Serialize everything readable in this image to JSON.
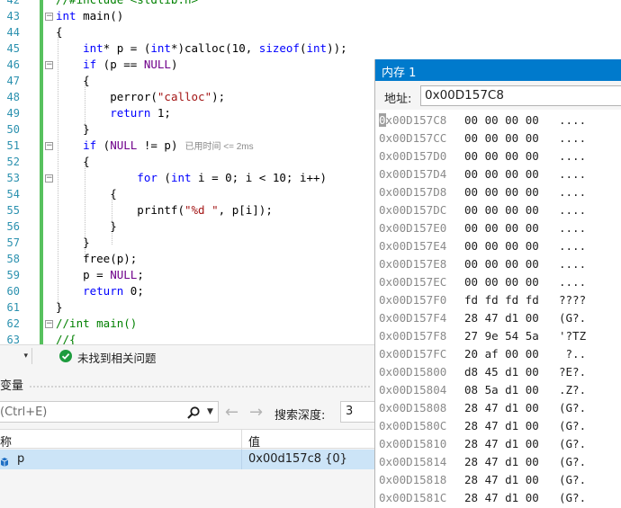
{
  "editor": {
    "lines": [
      {
        "num": "42",
        "tokens": [
          {
            "t": "//#include <stdlib.h>",
            "c": "cmt"
          }
        ]
      },
      {
        "num": "43",
        "tokens": [
          {
            "t": "int",
            "c": "kw"
          },
          {
            "t": " main()",
            "c": ""
          }
        ]
      },
      {
        "num": "44",
        "tokens": [
          {
            "t": "{",
            "c": ""
          }
        ]
      },
      {
        "num": "45",
        "tokens": [
          {
            "t": "    int",
            "c": "kw"
          },
          {
            "t": "* p = (",
            "c": ""
          },
          {
            "t": "int",
            "c": "kw"
          },
          {
            "t": "*)calloc(10, ",
            "c": ""
          },
          {
            "t": "sizeof",
            "c": "kw"
          },
          {
            "t": "(",
            "c": ""
          },
          {
            "t": "int",
            "c": "kw"
          },
          {
            "t": "));",
            "c": ""
          }
        ]
      },
      {
        "num": "46",
        "tokens": [
          {
            "t": "    if",
            "c": "kw"
          },
          {
            "t": " (p == ",
            "c": ""
          },
          {
            "t": "NULL",
            "c": "mac"
          },
          {
            "t": ")",
            "c": ""
          }
        ]
      },
      {
        "num": "47",
        "tokens": [
          {
            "t": "    {",
            "c": ""
          }
        ]
      },
      {
        "num": "48",
        "tokens": [
          {
            "t": "        perror(",
            "c": ""
          },
          {
            "t": "\"calloc\"",
            "c": "str"
          },
          {
            "t": ");",
            "c": ""
          }
        ]
      },
      {
        "num": "49",
        "tokens": [
          {
            "t": "        return",
            "c": "kw"
          },
          {
            "t": " 1;",
            "c": ""
          }
        ]
      },
      {
        "num": "50",
        "tokens": [
          {
            "t": "    }",
            "c": ""
          }
        ]
      },
      {
        "num": "51",
        "tokens": [
          {
            "t": "    if",
            "c": "kw"
          },
          {
            "t": " (",
            "c": ""
          },
          {
            "t": "NULL",
            "c": "mac"
          },
          {
            "t": " != p)",
            "c": ""
          }
        ]
      },
      {
        "num": "52",
        "tokens": [
          {
            "t": "    {",
            "c": ""
          }
        ]
      },
      {
        "num": "53",
        "tokens": [
          {
            "t": "            for",
            "c": "kw"
          },
          {
            "t": " (",
            "c": ""
          },
          {
            "t": "int",
            "c": "kw"
          },
          {
            "t": " i = 0; i < 10; i++)",
            "c": ""
          }
        ]
      },
      {
        "num": "54",
        "tokens": [
          {
            "t": "        {",
            "c": ""
          }
        ]
      },
      {
        "num": "55",
        "tokens": [
          {
            "t": "            printf(",
            "c": ""
          },
          {
            "t": "\"%d \"",
            "c": "str"
          },
          {
            "t": ", p[i]);",
            "c": ""
          }
        ]
      },
      {
        "num": "56",
        "tokens": [
          {
            "t": "        }",
            "c": ""
          }
        ]
      },
      {
        "num": "57",
        "tokens": [
          {
            "t": "    }",
            "c": ""
          }
        ]
      },
      {
        "num": "58",
        "tokens": [
          {
            "t": "    free(p);",
            "c": ""
          }
        ]
      },
      {
        "num": "59",
        "tokens": [
          {
            "t": "    p = ",
            "c": ""
          },
          {
            "t": "NULL",
            "c": "mac"
          },
          {
            "t": ";",
            "c": ""
          }
        ]
      },
      {
        "num": "60",
        "tokens": [
          {
            "t": "    return",
            "c": "kw"
          },
          {
            "t": " 0;",
            "c": ""
          }
        ]
      },
      {
        "num": "61",
        "tokens": [
          {
            "t": "}",
            "c": ""
          }
        ]
      },
      {
        "num": "62",
        "tokens": [
          {
            "t": "//int main()",
            "c": "cmt"
          }
        ]
      },
      {
        "num": "63",
        "tokens": [
          {
            "t": "//{",
            "c": "cmt"
          }
        ]
      }
    ],
    "perf_hint": "已用时间 <= 2ms"
  },
  "statusbar": {
    "issues_text": "未找到相关问题"
  },
  "variables": {
    "title": "变量",
    "search_placeholder": "(Ctrl+E)",
    "depth_label": "搜索深度:",
    "depth_value": "3",
    "col_name": "称",
    "col_value": "值",
    "rows": [
      {
        "name": "p",
        "value": "0x00d157c8 {0}"
      }
    ]
  },
  "memory": {
    "title": "内存 1",
    "addr_label": "地址:",
    "addr_value": "0x00D157C8",
    "rows": [
      {
        "addr": "0x00D157C8",
        "bytes": "00 00 00 00",
        "ascii": "...."
      },
      {
        "addr": "0x00D157CC",
        "bytes": "00 00 00 00",
        "ascii": "...."
      },
      {
        "addr": "0x00D157D0",
        "bytes": "00 00 00 00",
        "ascii": "...."
      },
      {
        "addr": "0x00D157D4",
        "bytes": "00 00 00 00",
        "ascii": "...."
      },
      {
        "addr": "0x00D157D8",
        "bytes": "00 00 00 00",
        "ascii": "...."
      },
      {
        "addr": "0x00D157DC",
        "bytes": "00 00 00 00",
        "ascii": "...."
      },
      {
        "addr": "0x00D157E0",
        "bytes": "00 00 00 00",
        "ascii": "...."
      },
      {
        "addr": "0x00D157E4",
        "bytes": "00 00 00 00",
        "ascii": "...."
      },
      {
        "addr": "0x00D157E8",
        "bytes": "00 00 00 00",
        "ascii": "...."
      },
      {
        "addr": "0x00D157EC",
        "bytes": "00 00 00 00",
        "ascii": "...."
      },
      {
        "addr": "0x00D157F0",
        "bytes": "fd fd fd fd",
        "ascii": "????"
      },
      {
        "addr": "0x00D157F4",
        "bytes": "28 47 d1 00",
        "ascii": "(G?."
      },
      {
        "addr": "0x00D157F8",
        "bytes": "27 9e 54 5a",
        "ascii": "'?TZ"
      },
      {
        "addr": "0x00D157FC",
        "bytes": "20 af 00 00",
        "ascii": " ?.."
      },
      {
        "addr": "0x00D15800",
        "bytes": "d8 45 d1 00",
        "ascii": "?E?."
      },
      {
        "addr": "0x00D15804",
        "bytes": "08 5a d1 00",
        "ascii": ".Z?."
      },
      {
        "addr": "0x00D15808",
        "bytes": "28 47 d1 00",
        "ascii": "(G?."
      },
      {
        "addr": "0x00D1580C",
        "bytes": "28 47 d1 00",
        "ascii": "(G?."
      },
      {
        "addr": "0x00D15810",
        "bytes": "28 47 d1 00",
        "ascii": "(G?."
      },
      {
        "addr": "0x00D15814",
        "bytes": "28 47 d1 00",
        "ascii": "(G?."
      },
      {
        "addr": "0x00D15818",
        "bytes": "28 47 d1 00",
        "ascii": "(G?."
      },
      {
        "addr": "0x00D1581C",
        "bytes": "28 47 d1 00",
        "ascii": "(G?."
      }
    ]
  },
  "colors": {
    "accent": "#007acc",
    "gutter_green": "#57c15e",
    "keyword": "#0000ff",
    "string": "#a31515",
    "comment": "#008000",
    "macro": "#6f008a",
    "line_number": "#2b91af",
    "selected_row": "#cce4f7"
  }
}
